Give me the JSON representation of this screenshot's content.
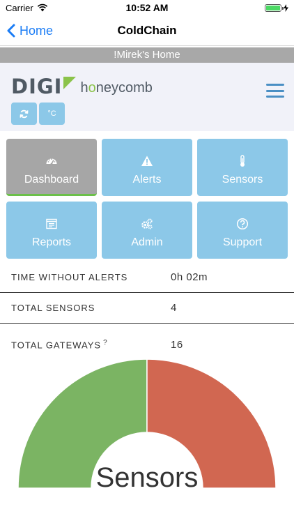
{
  "status_bar": {
    "carrier": "Carrier",
    "time": "10:52 AM",
    "battery_level": 1.0
  },
  "nav": {
    "back_label": "Home",
    "title": "ColdChain"
  },
  "banner": {
    "text": "!Mirek's Home"
  },
  "logo": {
    "brand": "DIGI",
    "product_prefix": "h",
    "product_accent": "o",
    "product_rest": "neycomb"
  },
  "header_buttons": {
    "refresh_icon": "refresh-icon",
    "unit_label": "°C"
  },
  "tiles": [
    {
      "label": "Dashboard",
      "icon": "dashboard-icon",
      "active": true
    },
    {
      "label": "Alerts",
      "icon": "warning-icon",
      "active": false
    },
    {
      "label": "Sensors",
      "icon": "thermometer-icon",
      "active": false
    },
    {
      "label": "Reports",
      "icon": "report-icon",
      "active": false
    },
    {
      "label": "Admin",
      "icon": "gears-icon",
      "active": false
    },
    {
      "label": "Support",
      "icon": "help-icon",
      "active": false
    }
  ],
  "stats": {
    "time_without_alerts": {
      "label": "TIME WITHOUT ALERTS",
      "value": "0h 02m"
    },
    "total_sensors": {
      "label": "TOTAL SENSORS",
      "value": "4"
    },
    "total_gateways": {
      "label": "TOTAL GATEWAYS",
      "value": "16",
      "help_mark": "?"
    }
  },
  "chart_data": {
    "type": "pie",
    "title": "Sensors",
    "shape": "half-donut",
    "slices": [
      {
        "value": 2,
        "color": "#7bb463"
      },
      {
        "value": 2,
        "color": "#d16751"
      }
    ]
  },
  "colors": {
    "tile": "#8cc8e8",
    "tile_active": "#a6a6a6",
    "accent_green": "#6cc04a",
    "link_blue": "#1a7cf5"
  }
}
